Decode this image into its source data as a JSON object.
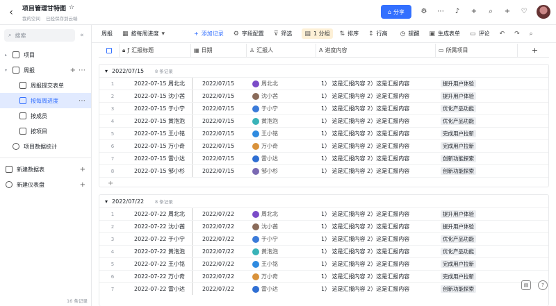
{
  "header": {
    "title": "项目管理甘特图",
    "workspace": "我的空间",
    "save_status": "已经保存到云端",
    "share_label": "分享"
  },
  "sidebar": {
    "search_placeholder": "搜索",
    "items": [
      {
        "label": "项目"
      },
      {
        "label": "周报"
      },
      {
        "label": "周报提交表单"
      },
      {
        "label": "按每周进度"
      },
      {
        "label": "按成员"
      },
      {
        "label": "按项目"
      },
      {
        "label": "项目数据统计"
      }
    ],
    "new_table": "新建数据表",
    "new_dashboard": "新建仪表盘"
  },
  "toolbar": {
    "table_name": "周报",
    "view_name": "按每周进度",
    "add_record": "添加记录",
    "field_config": "字段配置",
    "filter": "筛选",
    "group": "1 分组",
    "sort": "排序",
    "row_height": "行高",
    "remind": "提醒",
    "gen_form": "生成表单",
    "comment": "评论"
  },
  "columns": [
    "汇报标题",
    "日期",
    "汇报人",
    "进度内容",
    "所属项目"
  ],
  "groups": [
    {
      "name": "2022/07/15",
      "count": "8 条记录",
      "rows": [
        {
          "n": "1",
          "title": "2022-07-15 周北北",
          "date": "2022/07/15",
          "person": "周北北",
          "content": "1） 这是汇报内容 2）这是汇报内容",
          "project": "提升用户体验"
        },
        {
          "n": "2",
          "title": "2022-07-15 沈小茜",
          "date": "2022/07/15",
          "person": "沈小茜",
          "content": "1） 这是汇报内容 2）这是汇报内容",
          "project": "提升用户体验"
        },
        {
          "n": "3",
          "title": "2022-07-15 于小宁",
          "date": "2022/07/15",
          "person": "于小宁",
          "content": "1） 这是汇报内容 2）这是汇报内容",
          "project": "优化产品功能"
        },
        {
          "n": "4",
          "title": "2022-07-15 黄泡泡",
          "date": "2022/07/15",
          "person": "黄泡泡",
          "content": "1） 这是汇报内容 2）这是汇报内容",
          "project": "优化产品功能"
        },
        {
          "n": "5",
          "title": "2022-07-15 王小铭",
          "date": "2022/07/15",
          "person": "王小铭",
          "content": "1） 这是汇报内容 2）这是汇报内容",
          "project": "完成用户拉新"
        },
        {
          "n": "6",
          "title": "2022-07-15 万小奇",
          "date": "2022/07/15",
          "person": "万小奇",
          "content": "1） 这是汇报内容 2）这是汇报内容",
          "project": "完成用户拉新"
        },
        {
          "n": "7",
          "title": "2022-07-15 雷小达",
          "date": "2022/07/15",
          "person": "雷小达",
          "content": "1） 这是汇报内容 2）这是汇报内容",
          "project": "创新功能探索"
        },
        {
          "n": "8",
          "title": "2022-07-15 邹小杉",
          "date": "2022/07/15",
          "person": "邹小杉",
          "content": "1） 这是汇报内容 2）这是汇报内容",
          "project": "创新功能探索"
        }
      ]
    },
    {
      "name": "2022/07/22",
      "count": "8 条记录",
      "rows": [
        {
          "n": "1",
          "title": "2022-07-22 周北北",
          "date": "2022/07/22",
          "person": "周北北",
          "content": "1） 这是汇报内容 2）这是汇报内容",
          "project": "提升用户体验"
        },
        {
          "n": "2",
          "title": "2022-07-22 沈小茜",
          "date": "2022/07/22",
          "person": "沈小茜",
          "content": "1） 这是汇报内容 2）这是汇报内容",
          "project": "提升用户体验"
        },
        {
          "n": "3",
          "title": "2022-07-22 于小宁",
          "date": "2022/07/22",
          "person": "于小宁",
          "content": "1） 这是汇报内容 2）这是汇报内容",
          "project": "优化产品功能"
        },
        {
          "n": "4",
          "title": "2022-07-22 黄泡泡",
          "date": "2022/07/22",
          "person": "黄泡泡",
          "content": "1） 这是汇报内容 2）这是汇报内容",
          "project": "优化产品功能"
        },
        {
          "n": "5",
          "title": "2022-07-22 王小铭",
          "date": "2022/07/22",
          "person": "王小铭",
          "content": "1） 这是汇报内容 2）这是汇报内容",
          "project": "完成用户拉新"
        },
        {
          "n": "6",
          "title": "2022-07-22 万小奇",
          "date": "2022/07/22",
          "person": "万小奇",
          "content": "1） 这是汇报内容 2）这是汇报内容",
          "project": "完成用户拉新"
        },
        {
          "n": "7",
          "title": "2022-07-22 雷小达",
          "date": "2022/07/22",
          "person": "雷小达",
          "content": "1） 这是汇报内容 2）这是汇报内容",
          "project": "创新功能探索"
        }
      ]
    }
  ],
  "footer_count": "16 条记录",
  "avatar_colors": [
    "#7b4cc8",
    "#8a6b5a",
    "#3b7bd9",
    "#39b3b8",
    "#2f8be0",
    "#d9923b",
    "#2f6fd3",
    "#7a69b3"
  ]
}
